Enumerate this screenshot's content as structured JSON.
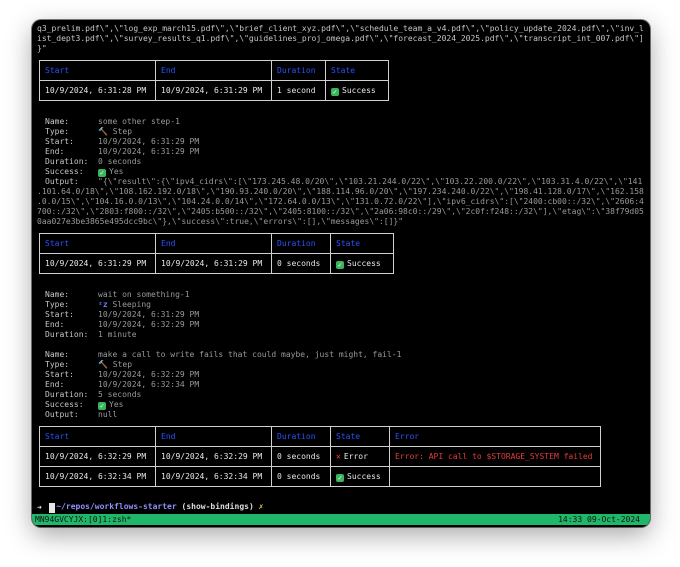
{
  "output_head": [
    "q3_prelim.pdf\\\",\\\"log_exp_march15.pdf\\\",\\\"brief_client_xyz.pdf\\\",\\\"schedule_team_a_v4.pdf\\\",\\\"policy_update_2024.pdf\\\",\\\"inv_l",
    "ist_dept3.pdf\\\",\\\"survey_results_q1.pdf\\\",\\\"guidelines_proj_omega.pdf\\\",\\\"forecast_2024_2025.pdf\\\",\\\"transcript_int_007.pdf\\\"]",
    "}\""
  ],
  "table_headers": {
    "start": "Start",
    "end": "End",
    "duration": "Duration",
    "state": "State",
    "error": "Error"
  },
  "table1": {
    "start": "10/9/2024, 6:31:28 PM",
    "end": "10/9/2024, 6:31:29 PM",
    "duration": "1 second",
    "state": "Success"
  },
  "step1": {
    "name_label": "Name:",
    "name": "some other step-1",
    "type_label": "Type:",
    "type": "Step",
    "start_label": "Start:",
    "start": "10/9/2024, 6:31:29 PM",
    "end_label": "End:",
    "end": "10/9/2024, 6:31:29 PM",
    "duration_label": "Duration:",
    "duration": "0 seconds",
    "success_label": "Success:",
    "success": "Yes",
    "output_label": "Output:",
    "output_lines": [
      "\"{\\\"result\\\":{\\\"ipv4_cidrs\\\":[\\\"173.245.48.0/20\\\",\\\"103.21.244.0/22\\\",\\\"103.22.200.0/22\\\",\\\"103.31.4.0/22\\\",\\\"141",
      ".101.64.0/18\\\",\\\"108.162.192.0/18\\\",\\\"190.93.240.0/20\\\",\\\"188.114.96.0/20\\\",\\\"197.234.240.0/22\\\",\\\"198.41.128.0/17\\\",\\\"162.158",
      ".0.0/15\\\",\\\"104.16.0.0/13\\\",\\\"104.24.0.0/14\\\",\\\"172.64.0.0/13\\\",\\\"131.0.72.0/22\\\"],\\\"ipv6_cidrs\\\":[\\\"2400:cb00::/32\\\",\\\"2606:4",
      "700::/32\\\",\\\"2803:f800::/32\\\",\\\"2405:b500::/32\\\",\\\"2405:8100::/32\\\",\\\"2a06:98c0::/29\\\",\\\"2c0f:f248::/32\\\"],\\\"etag\\\":\\\"38f79d05",
      "0aa027e3be3865e495dcc9bc\\\"},\\\"success\\\":true,\\\"errors\\\":[],\\\"messages\\\":[]}\""
    ]
  },
  "table2": {
    "start": "10/9/2024, 6:31:29 PM",
    "end": "10/9/2024, 6:31:29 PM",
    "duration": "0 seconds",
    "state": "Success"
  },
  "step2": {
    "name_label": "Name:",
    "name": "wait on something-1",
    "type_label": "Type:",
    "type": "Sleeping",
    "start_label": "Start:",
    "start": "10/9/2024, 6:31:29 PM",
    "end_label": "End:",
    "end": "10/9/2024, 6:32:29 PM",
    "duration_label": "Duration:",
    "duration": "1 minute"
  },
  "step3": {
    "name_label": "Name:",
    "name": "make a call to write fails that could maybe, just might, fail-1",
    "type_label": "Type:",
    "type": "Step",
    "start_label": "Start:",
    "start": "10/9/2024, 6:32:29 PM",
    "end_label": "End:",
    "end": "10/9/2024, 6:32:34 PM",
    "duration_label": "Duration:",
    "duration": "5 seconds",
    "success_label": "Success:",
    "success": "Yes",
    "output_label": "Output:",
    "output": "null"
  },
  "table3": [
    {
      "start": "10/9/2024, 6:32:29 PM",
      "end": "10/9/2024, 6:32:29 PM",
      "duration": "0 seconds",
      "state": "Error",
      "error": "Error: API call to $STORAGE_SYSTEM failed"
    },
    {
      "start": "10/9/2024, 6:32:34 PM",
      "end": "10/9/2024, 6:32:34 PM",
      "duration": "0 seconds",
      "state": "Success",
      "error": ""
    }
  ],
  "prompt": {
    "path": "~/repos/workflows-starter",
    "branch": "(show-bindings)",
    "dirty": "✗",
    "arrow": "➜"
  },
  "statusbar": {
    "left": "MN94GVCYJX:[0]1:zsh*",
    "right": "14:33 09-Oct-2024"
  },
  "icons": {
    "success": "check-box-icon",
    "error": "cross-icon",
    "step": "wrench-icon",
    "sleep": "zzz-icon"
  },
  "colors": {
    "success": "#3bb55c",
    "error": "#e53b3b",
    "header": "#2a52ff",
    "statusbar": "#1fb86a"
  }
}
